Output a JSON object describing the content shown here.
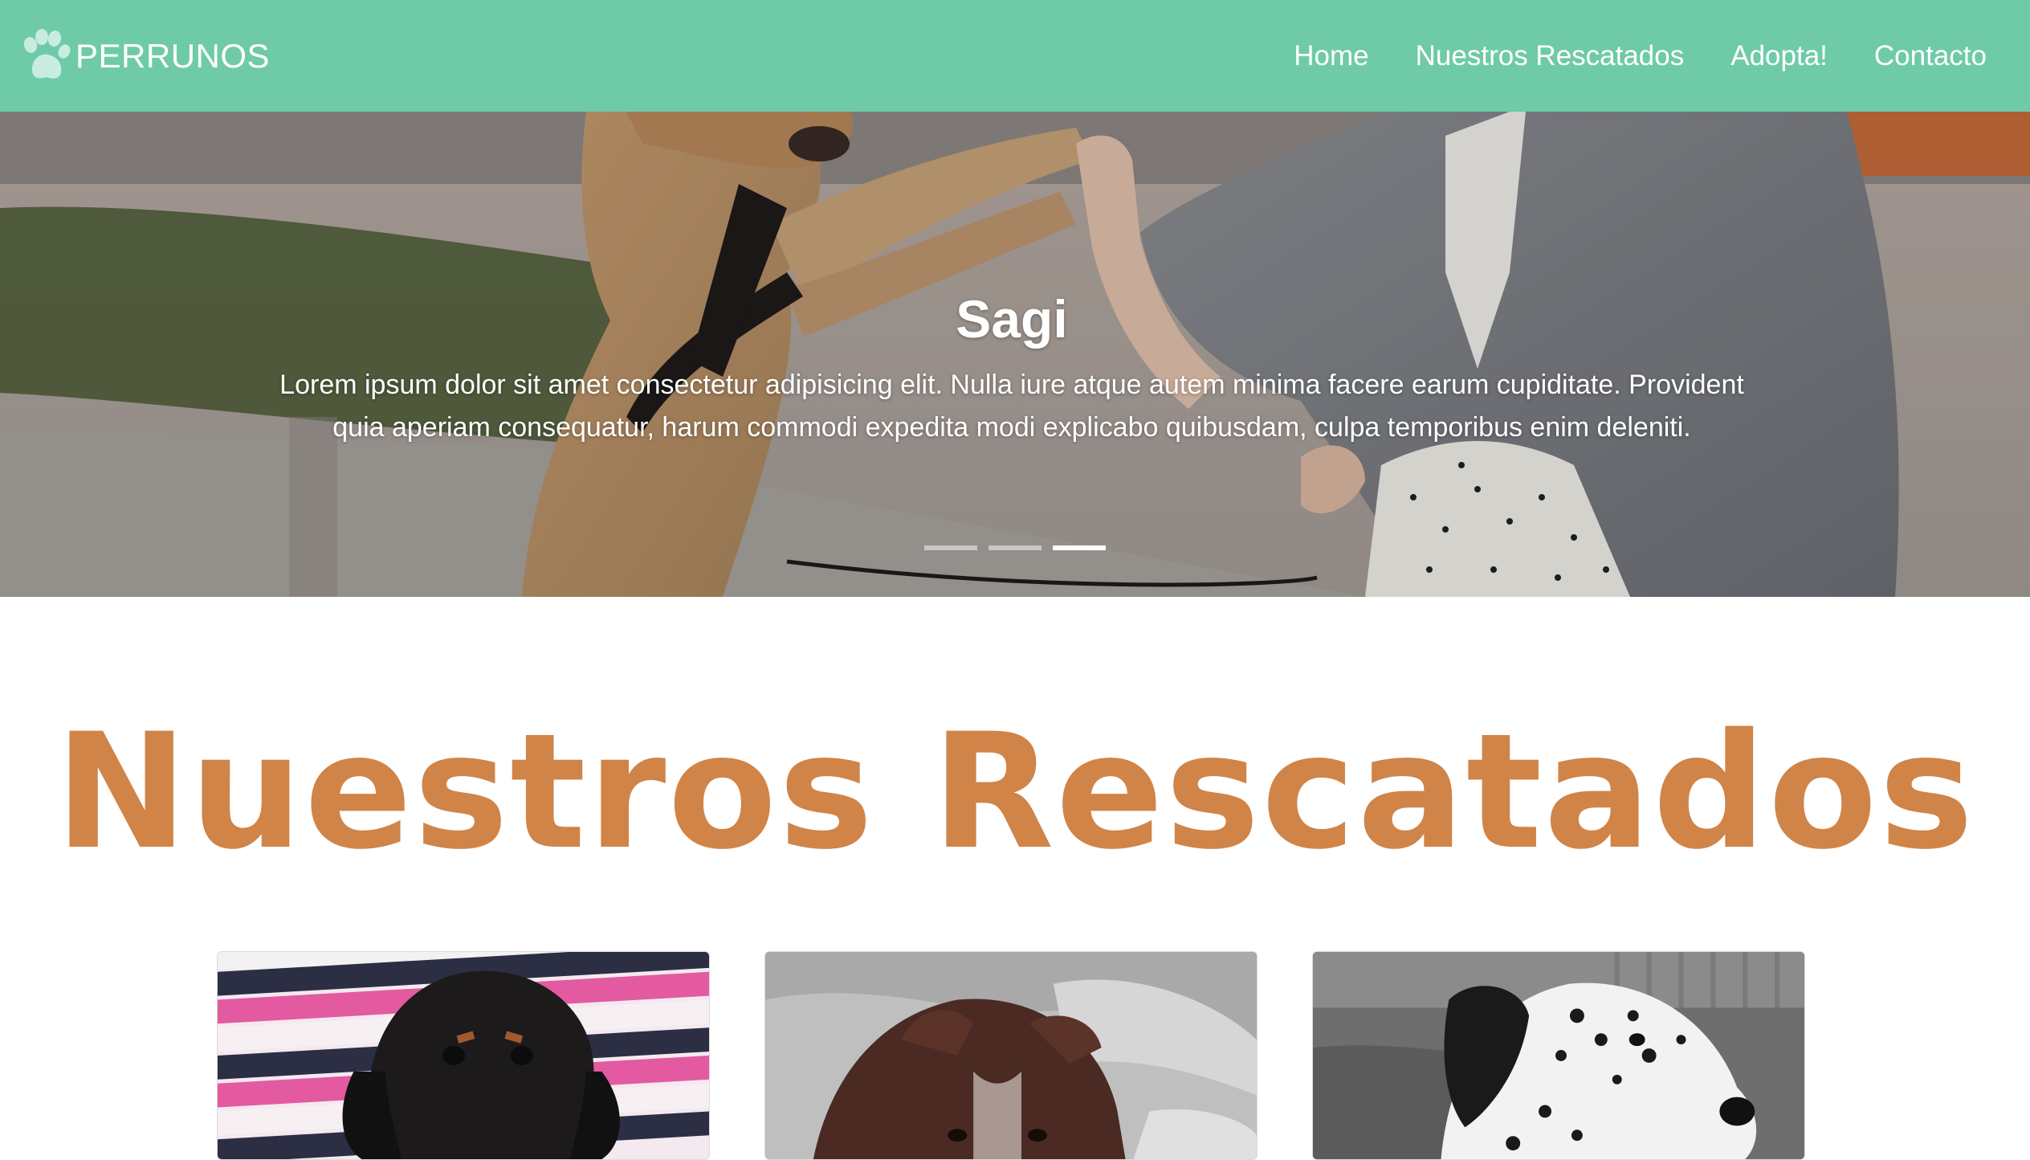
{
  "navbar": {
    "brand": "PERRUNOS",
    "brand_icon": "paw-icon",
    "links": [
      "Home",
      "Nuestros Rescatados",
      "Adopta!",
      "Contacto"
    ]
  },
  "hero": {
    "title": "Sagi",
    "text": "Lorem ipsum dolor sit amet consectetur adipisicing elit. Nulla iure atque autem minima facere earum cupiditate. Provident quia aperiam consequatur, harum commodi expedita modi explicabo quibusdam, culpa temporibus enim deleniti.",
    "slide_count": 3,
    "active_slide": 3
  },
  "section": {
    "title": "Nuestros Rescatados"
  },
  "colors": {
    "navbar": "#6fcaa8",
    "accent": "#d08448"
  }
}
